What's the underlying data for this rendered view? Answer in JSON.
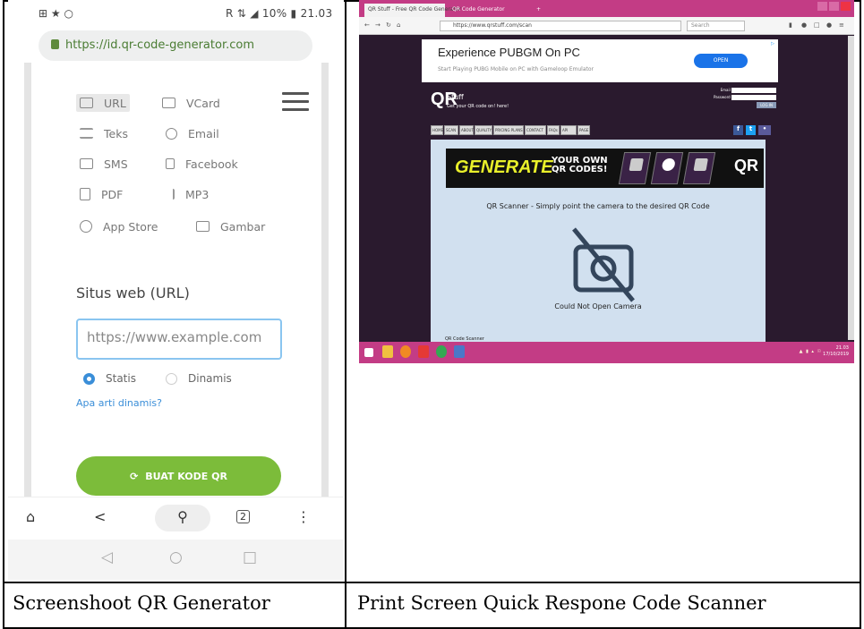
{
  "phone": {
    "status_left": "⊞ ★ ○",
    "status_right": "R ⇅ ◢ 10% ▮ 21.03",
    "url": "https://id.qr-code-generator.com",
    "menu": [
      {
        "label": "URL",
        "icon": "url-icon"
      },
      {
        "label": "VCard",
        "icon": "vcard-icon"
      },
      {
        "label": "Teks",
        "icon": "text-icon"
      },
      {
        "label": "Email",
        "icon": "email-icon"
      },
      {
        "label": "SMS",
        "icon": "sms-icon"
      },
      {
        "label": "Facebook",
        "icon": "facebook-icon"
      },
      {
        "label": "PDF",
        "icon": "pdf-icon"
      },
      {
        "label": "MP3",
        "icon": "mp3-icon"
      },
      {
        "label": "App Store",
        "icon": "app-store-icon"
      },
      {
        "label": "Gambar",
        "icon": "image-icon"
      }
    ],
    "section_title": "Situs web (URL)",
    "url_placeholder": "https://www.example.com",
    "radio_static": "Statis",
    "radio_dynamic": "Dinamis",
    "help_link": "Apa arti dinamis?",
    "create_button": "BUAT KODE QR",
    "nav_icons": [
      "home-icon",
      "share-icon",
      "search-icon",
      "tabs-icon",
      "more-icon"
    ],
    "nav_tab_count": "2",
    "sys_icons": [
      "back-icon",
      "home-circle-icon",
      "recents-icon"
    ]
  },
  "desktop": {
    "tab1": "QR Stuff - Free QR Code Generator",
    "tab2": "QR Code Generator",
    "address": "https://www.qrstuff.com/scan",
    "search_placeholder": "Search",
    "ad_title": "Experience PUBGM On PC",
    "ad_subtitle": "Start Playing PUBG Mobile on PC with Gameloop Emulator",
    "ad_button": "OPEN",
    "logo_mark": "QR",
    "logo_name": "Stuff",
    "logo_tagline": "Get your QR code on! here!",
    "login_email": "Email",
    "login_password": "Password",
    "login_button": "LOG IN",
    "nav_tabs": [
      "HOME",
      "SCAN",
      "ABOUT",
      "QUALITY",
      "PRICING PLANS",
      "CONTACT",
      "FAQs",
      "API",
      "PAGE"
    ],
    "banner_generate": "GENERATE",
    "banner_your_own": "YOUR OWN",
    "banner_qr_codes": "QR CODES!",
    "banner_logo": "QR",
    "scan_message": "QR Scanner - Simply point the camera to the desired QR Code",
    "camera_status": "Could Not Open Camera",
    "scanner_label": "QR Code Scanner",
    "taskbar_time": "21.03",
    "taskbar_date": "17/10/2019"
  },
  "captions": {
    "left": "Screenshoot QR Generator",
    "right": "Print Screen Quick Respone Code Scanner"
  },
  "colors": {
    "phone_accent_green": "#7cbc3a",
    "phone_link_blue": "#3a8ed8",
    "browser_chrome_pink": "#c33c85",
    "banner_yellow": "#e9f02a",
    "scanner_bg": "#d1e0ef"
  }
}
